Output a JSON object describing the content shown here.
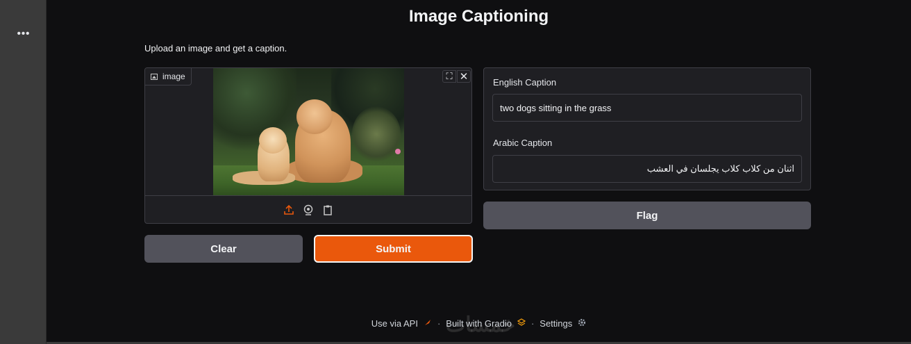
{
  "sidebar": {
    "menu_label": "•••"
  },
  "header": {
    "title": "Image Captioning",
    "description": "Upload an image and get a caption."
  },
  "image_input": {
    "label": "image",
    "expand_glyph": "⛶",
    "close_glyph": "✕",
    "toolbar": [
      "upload-icon",
      "webcam-icon",
      "clipboard-icon"
    ]
  },
  "buttons": {
    "clear": "Clear",
    "submit": "Submit",
    "flag": "Flag"
  },
  "outputs": {
    "english": {
      "label": "English Caption",
      "value": "two dogs sitting in the grass"
    },
    "arabic": {
      "label": "Arabic Caption",
      "value": "اثنان من كلاب كلاب يجلسان في العشب"
    }
  },
  "footer": {
    "api": "Use via API",
    "built": "Built with Gradio",
    "settings": "Settings",
    "separator": "·"
  },
  "watermark": "خمسات",
  "colors": {
    "accent": "#ea580c",
    "background": "#0f0f11",
    "panel": "#1f1f23",
    "button": "#52525b"
  }
}
